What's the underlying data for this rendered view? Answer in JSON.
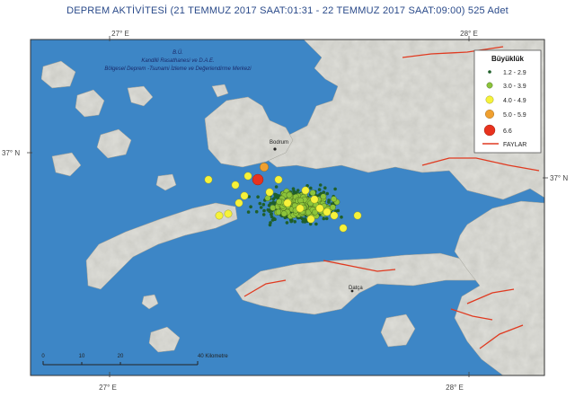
{
  "title": "DEPREM AKTİVİTESİ  (21 TEMMUZ 2017 SAAT:01:31 - 22 TEMMUZ 2017 SAAT:09:00)  525 Adet",
  "graticule": {
    "top_lon_left": "27° E",
    "top_lon_right": "28° E",
    "bottom_lon_left": "27° E",
    "bottom_lon_right": "28° E",
    "lat_left": "37° N",
    "lat_right": "37° N"
  },
  "credit": {
    "line1": "B.Ü.",
    "line2": "Kandilli Rasathanesi ve D.A.E.",
    "line3": "Bölgesel Deprem -Tsunami İzleme ve Değerlendirme Merkezi"
  },
  "places": {
    "bodrum": "Bodrum",
    "datca": "Datça"
  },
  "legend": {
    "title": "Büyüklük",
    "items": [
      {
        "label": "1.2 - 2.9",
        "color": "#1f5f2a"
      },
      {
        "label": "3.0 - 3.9",
        "color": "#8cc43a"
      },
      {
        "label": "4.0 - 4.9",
        "color": "#f6f23a"
      },
      {
        "label": "5.0 - 5.9",
        "color": "#f0a030"
      },
      {
        "label": "6.6",
        "color": "#e8321e"
      },
      {
        "label": "FAYLAR",
        "color": "#e03a20"
      }
    ]
  },
  "scale_bar": {
    "labels": [
      "0",
      "10",
      "20",
      "40 Kilometre"
    ]
  },
  "colors": {
    "sea": "#3d86c6",
    "land": "#e0e0da",
    "fault": "#e03a20"
  }
}
